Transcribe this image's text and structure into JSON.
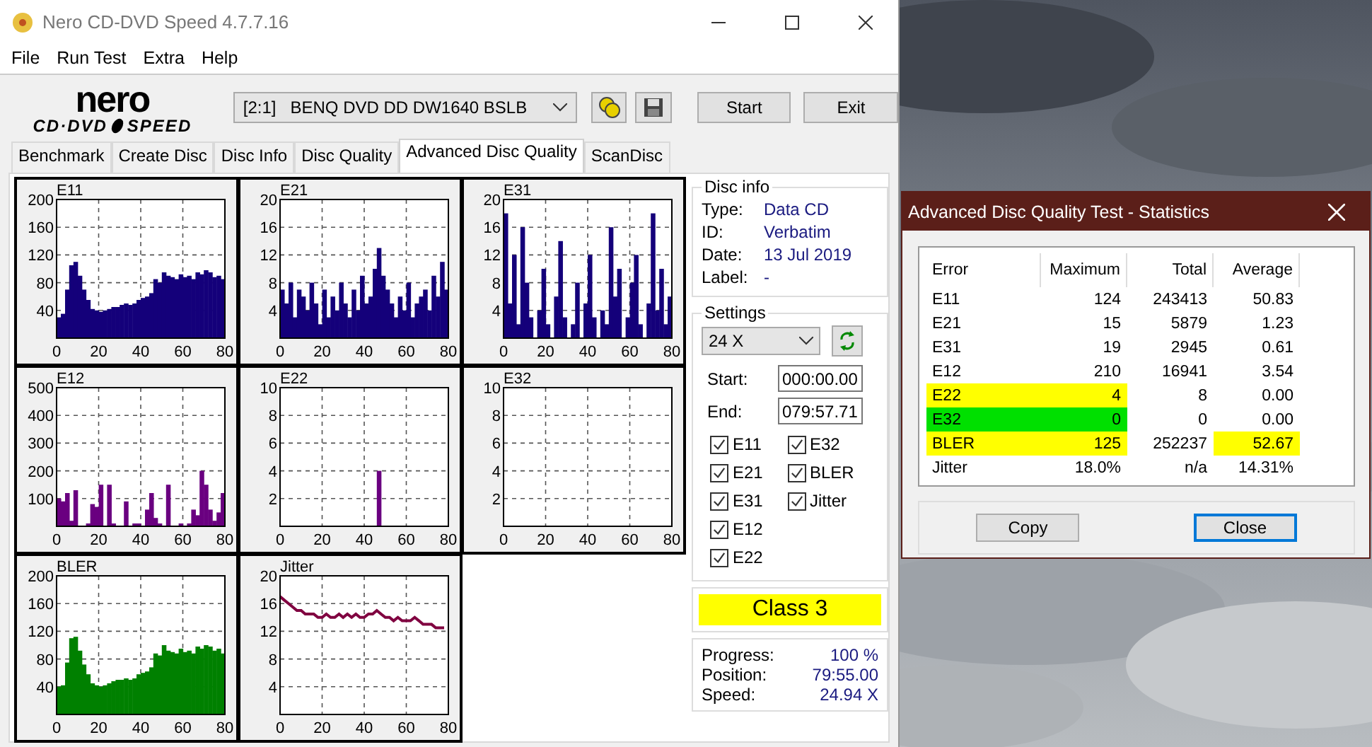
{
  "window": {
    "title": "Nero CD-DVD Speed 4.7.7.16"
  },
  "menu": [
    "File",
    "Run Test",
    "Extra",
    "Help"
  ],
  "logo": {
    "brand": "nero",
    "product_left": "CD·DVD",
    "product_right": "SPEED"
  },
  "toolbar": {
    "drive": "[2:1]   BENQ DVD DD DW1640 BSLB",
    "buttons": [
      "Start",
      "Exit"
    ]
  },
  "tabs": [
    {
      "label": "Benchmark",
      "selected": false
    },
    {
      "label": "Create Disc",
      "selected": false
    },
    {
      "label": "Disc Info",
      "selected": false
    },
    {
      "label": "Disc Quality",
      "selected": false
    },
    {
      "label": "Advanced Disc Quality",
      "selected": true
    },
    {
      "label": "ScanDisc",
      "selected": false
    }
  ],
  "charts": [
    {
      "chart_data": {
        "type": "bar",
        "title": "E11",
        "xlim": [
          0,
          80
        ],
        "ylim": [
          0,
          200
        ],
        "grid": true,
        "xticks": [
          0,
          20,
          40,
          60,
          80
        ],
        "yticks": [
          40,
          80,
          120,
          160,
          200
        ],
        "series": [
          {
            "color": "#14007a",
            "x": [
              0,
              2,
              4,
              6,
              8,
              10,
              12,
              14,
              16,
              18,
              20,
              22,
              24,
              26,
              28,
              30,
              32,
              34,
              36,
              38,
              40,
              42,
              44,
              46,
              48,
              50,
              52,
              54,
              56,
              58,
              60,
              62,
              64,
              66,
              68,
              70,
              72,
              74,
              76,
              78
            ],
            "values": [
              30,
              35,
              70,
              105,
              110,
              90,
              70,
              55,
              42,
              40,
              38,
              40,
              42,
              45,
              45,
              48,
              50,
              48,
              50,
              55,
              58,
              60,
              65,
              85,
              80,
              95,
              90,
              88,
              85,
              92,
              88,
              90,
              85,
              95,
              92,
              98,
              95,
              88,
              90,
              85
            ]
          }
        ]
      }
    },
    {
      "chart_data": {
        "type": "bar",
        "title": "E21",
        "xlim": [
          0,
          80
        ],
        "ylim": [
          0,
          20
        ],
        "grid": true,
        "xticks": [
          0,
          20,
          40,
          60,
          80
        ],
        "yticks": [
          4,
          8,
          12,
          16,
          20
        ],
        "series": [
          {
            "color": "#14007a",
            "x": [
              0,
              2,
              4,
              6,
              8,
              10,
              12,
              14,
              16,
              18,
              20,
              22,
              24,
              26,
              28,
              30,
              32,
              34,
              36,
              38,
              40,
              42,
              44,
              46,
              48,
              50,
              52,
              54,
              56,
              58,
              60,
              62,
              64,
              66,
              68,
              70,
              72,
              74,
              76,
              78
            ],
            "values": [
              7,
              5,
              8,
              3,
              7,
              6,
              4,
              8,
              5,
              2,
              7,
              3,
              6,
              4,
              8,
              5,
              3,
              7,
              4,
              9,
              5,
              6,
              10,
              13,
              9,
              7,
              5,
              3,
              6,
              4,
              8,
              3,
              5,
              6,
              7,
              4,
              9,
              6,
              11,
              7
            ]
          }
        ]
      }
    },
    {
      "chart_data": {
        "type": "bar",
        "title": "E31",
        "xlim": [
          0,
          80
        ],
        "ylim": [
          0,
          20
        ],
        "grid": true,
        "xticks": [
          0,
          20,
          40,
          60,
          80
        ],
        "yticks": [
          4,
          8,
          12,
          16,
          20
        ],
        "series": [
          {
            "color": "#14007a",
            "x": [
              0,
              2,
              4,
              6,
              8,
              10,
              12,
              14,
              16,
              18,
              20,
              22,
              24,
              26,
              28,
              30,
              32,
              34,
              36,
              38,
              40,
              42,
              44,
              46,
              48,
              50,
              52,
              54,
              56,
              58,
              60,
              62,
              64,
              66,
              68,
              70,
              72,
              74,
              76,
              78
            ],
            "values": [
              18,
              5,
              12,
              2,
              16,
              8,
              3,
              0,
              4,
              10,
              2,
              0,
              6,
              14,
              3,
              0,
              2,
              8,
              0,
              5,
              12,
              3,
              0,
              4,
              2,
              16,
              6,
              10,
              0,
              3,
              8,
              12,
              2,
              0,
              5,
              18,
              4,
              10,
              2,
              6
            ]
          }
        ]
      }
    },
    {
      "chart_data": {
        "type": "bar",
        "title": "E12",
        "xlim": [
          0,
          80
        ],
        "ylim": [
          0,
          500
        ],
        "grid": true,
        "xticks": [
          0,
          20,
          40,
          60,
          80
        ],
        "yticks": [
          100,
          200,
          300,
          400,
          500
        ],
        "series": [
          {
            "color": "#6a0080",
            "x": [
              0,
              2,
              4,
              6,
              8,
              10,
              12,
              14,
              16,
              18,
              20,
              22,
              24,
              26,
              28,
              30,
              32,
              34,
              36,
              38,
              40,
              42,
              44,
              46,
              48,
              50,
              52,
              54,
              56,
              58,
              60,
              62,
              64,
              66,
              68,
              70,
              72,
              74,
              76,
              78
            ],
            "values": [
              100,
              90,
              120,
              20,
              130,
              0,
              0,
              10,
              80,
              70,
              150,
              0,
              150,
              10,
              0,
              0,
              90,
              0,
              10,
              10,
              0,
              60,
              120,
              30,
              10,
              0,
              150,
              0,
              0,
              10,
              0,
              10,
              60,
              40,
              200,
              150,
              60,
              20,
              50,
              120
            ]
          }
        ]
      }
    },
    {
      "chart_data": {
        "type": "bar",
        "title": "E22",
        "xlim": [
          0,
          80
        ],
        "ylim": [
          0,
          10
        ],
        "grid": true,
        "xticks": [
          0,
          20,
          40,
          60,
          80
        ],
        "yticks": [
          2,
          4,
          6,
          8,
          10
        ],
        "series": [
          {
            "color": "#6a0080",
            "x": [
              0,
              2,
              4,
              6,
              8,
              10,
              12,
              14,
              16,
              18,
              20,
              22,
              24,
              26,
              28,
              30,
              32,
              34,
              36,
              38,
              40,
              42,
              44,
              46,
              48,
              50,
              52,
              54,
              56,
              58,
              60,
              62,
              64,
              66,
              68,
              70,
              72,
              74,
              76,
              78
            ],
            "values": [
              0,
              0,
              0,
              0,
              0,
              0,
              0,
              0,
              0,
              0,
              0,
              0,
              0,
              0,
              0,
              0,
              0,
              0,
              0,
              0,
              0,
              0,
              0,
              4,
              0,
              0,
              0,
              0,
              0,
              0,
              0,
              0,
              0,
              0,
              0,
              0,
              0,
              0,
              0,
              0
            ]
          }
        ]
      }
    },
    {
      "chart_data": {
        "type": "bar",
        "title": "E32",
        "xlim": [
          0,
          80
        ],
        "ylim": [
          0,
          10
        ],
        "grid": true,
        "xticks": [
          0,
          20,
          40,
          60,
          80
        ],
        "yticks": [
          2,
          4,
          6,
          8,
          10
        ],
        "series": [
          {
            "x": [
              0,
              2,
              4,
              6,
              8,
              10,
              12,
              14,
              16,
              18,
              20,
              22,
              24,
              26,
              28,
              30,
              32,
              34,
              36,
              38,
              40,
              42,
              44,
              46,
              48,
              50,
              52,
              54,
              56,
              58,
              60,
              62,
              64,
              66,
              68,
              70,
              72,
              74,
              76,
              78
            ],
            "values": [
              0,
              0,
              0,
              0,
              0,
              0,
              0,
              0,
              0,
              0,
              0,
              0,
              0,
              0,
              0,
              0,
              0,
              0,
              0,
              0,
              0,
              0,
              0,
              0,
              0,
              0,
              0,
              0,
              0,
              0,
              0,
              0,
              0,
              0,
              0,
              0,
              0,
              0,
              0,
              0
            ]
          }
        ]
      }
    },
    {
      "chart_data": {
        "type": "bar",
        "title": "BLER",
        "xlim": [
          0,
          80
        ],
        "ylim": [
          0,
          200
        ],
        "grid": true,
        "xticks": [
          0,
          20,
          40,
          60,
          80
        ],
        "yticks": [
          40,
          80,
          120,
          160,
          200
        ],
        "series": [
          {
            "color": "#008000",
            "x": [
              0,
              2,
              4,
              6,
              8,
              10,
              12,
              14,
              16,
              18,
              20,
              22,
              24,
              26,
              28,
              30,
              32,
              34,
              36,
              38,
              40,
              42,
              44,
              46,
              48,
              50,
              52,
              54,
              56,
              58,
              60,
              62,
              64,
              66,
              68,
              70,
              72,
              74,
              76,
              78
            ],
            "values": [
              40,
              42,
              75,
              110,
              112,
              92,
              72,
              58,
              45,
              42,
              40,
              42,
              45,
              48,
              50,
              50,
              52,
              50,
              52,
              58,
              60,
              62,
              68,
              88,
              85,
              100,
              92,
              90,
              88,
              95,
              90,
              92,
              88,
              98,
              95,
              100,
              98,
              92,
              95,
              88
            ]
          }
        ]
      }
    },
    {
      "chart_data": {
        "type": "line",
        "title": "Jitter",
        "xlim": [
          0,
          80
        ],
        "ylim": [
          0,
          20
        ],
        "grid": true,
        "xticks": [
          0,
          20,
          40,
          60,
          80
        ],
        "yticks": [
          4,
          8,
          12,
          16,
          20
        ],
        "series": [
          {
            "color": "#800040",
            "x": [
              0,
              2,
              4,
              6,
              8,
              10,
              12,
              14,
              16,
              18,
              20,
              22,
              24,
              26,
              28,
              30,
              32,
              34,
              36,
              38,
              40,
              42,
              44,
              46,
              48,
              50,
              52,
              54,
              56,
              58,
              60,
              62,
              64,
              66,
              68,
              70,
              72,
              74,
              76,
              78
            ],
            "values": [
              17,
              16.5,
              16,
              15.5,
              15,
              15,
              14.5,
              14.5,
              14.5,
              14,
              14,
              14.5,
              14,
              14,
              14.5,
              14,
              14.5,
              14,
              14.5,
              14,
              14,
              14.5,
              14.5,
              15,
              14.5,
              14,
              14,
              13.5,
              14,
              13.5,
              13.5,
              13.5,
              14,
              13.5,
              13,
              13,
              13,
              12.5,
              12.5,
              12.5
            ]
          }
        ]
      }
    }
  ],
  "disc_info": {
    "title": "Disc info",
    "fields": [
      {
        "label": "Type:",
        "value": "Data CD"
      },
      {
        "label": "ID:",
        "value": "Verbatim"
      },
      {
        "label": "Date:",
        "value": "13 Jul 2019"
      },
      {
        "label": "Label:",
        "value": "-"
      }
    ]
  },
  "settings": {
    "title": "Settings",
    "speed": "24 X",
    "start_label": "Start:",
    "start": "000:00.00",
    "end_label": "End:",
    "end": "079:57.71",
    "tests": [
      {
        "label": "E11",
        "checked": true
      },
      {
        "label": "E21",
        "checked": true
      },
      {
        "label": "E31",
        "checked": true
      },
      {
        "label": "E12",
        "checked": true
      },
      {
        "label": "E22",
        "checked": true
      },
      {
        "label": "E32",
        "checked": true
      },
      {
        "label": "BLER",
        "checked": true
      },
      {
        "label": "Jitter",
        "checked": true
      }
    ]
  },
  "result": {
    "text": "Class 3",
    "color": "#ffff00"
  },
  "progress": [
    {
      "label": "Progress:",
      "value": "100 %"
    },
    {
      "label": "Position:",
      "value": "79:55.00"
    },
    {
      "label": "Speed:",
      "value": "24.94 X"
    }
  ],
  "dialog": {
    "title": "Advanced Disc Quality Test - Statistics",
    "columns": [
      "Error",
      "Maximum",
      "Total",
      "Average"
    ],
    "rows": [
      {
        "cells": [
          {
            "text": "E11"
          },
          {
            "text": "124"
          },
          {
            "text": "243413"
          },
          {
            "text": "50.83"
          }
        ]
      },
      {
        "cells": [
          {
            "text": "E21"
          },
          {
            "text": "15"
          },
          {
            "text": "5879"
          },
          {
            "text": "1.23"
          }
        ]
      },
      {
        "cells": [
          {
            "text": "E31"
          },
          {
            "text": "19"
          },
          {
            "text": "2945"
          },
          {
            "text": "0.61"
          }
        ]
      },
      {
        "cells": [
          {
            "text": "E12"
          },
          {
            "text": "210"
          },
          {
            "text": "16941"
          },
          {
            "text": "3.54"
          }
        ]
      },
      {
        "cells": [
          {
            "text": "E22",
            "color": "#ffff00"
          },
          {
            "text": "4",
            "color": "#ffff00"
          },
          {
            "text": "8"
          },
          {
            "text": "0.00"
          }
        ]
      },
      {
        "cells": [
          {
            "text": "E32",
            "color": "#00e000"
          },
          {
            "text": "0",
            "color": "#00e000"
          },
          {
            "text": "0"
          },
          {
            "text": "0.00"
          }
        ]
      },
      {
        "cells": [
          {
            "text": "BLER",
            "color": "#ffff00"
          },
          {
            "text": "125",
            "color": "#ffff00"
          },
          {
            "text": "252237"
          },
          {
            "text": "52.67",
            "color": "#ffff00"
          }
        ]
      },
      {
        "cells": [
          {
            "text": "Jitter"
          },
          {
            "text": "18.0%"
          },
          {
            "text": "n/a"
          },
          {
            "text": "14.31%"
          }
        ]
      }
    ],
    "buttons": [
      {
        "label": "Copy",
        "focused": false
      },
      {
        "label": "Close",
        "focused": true
      }
    ]
  }
}
